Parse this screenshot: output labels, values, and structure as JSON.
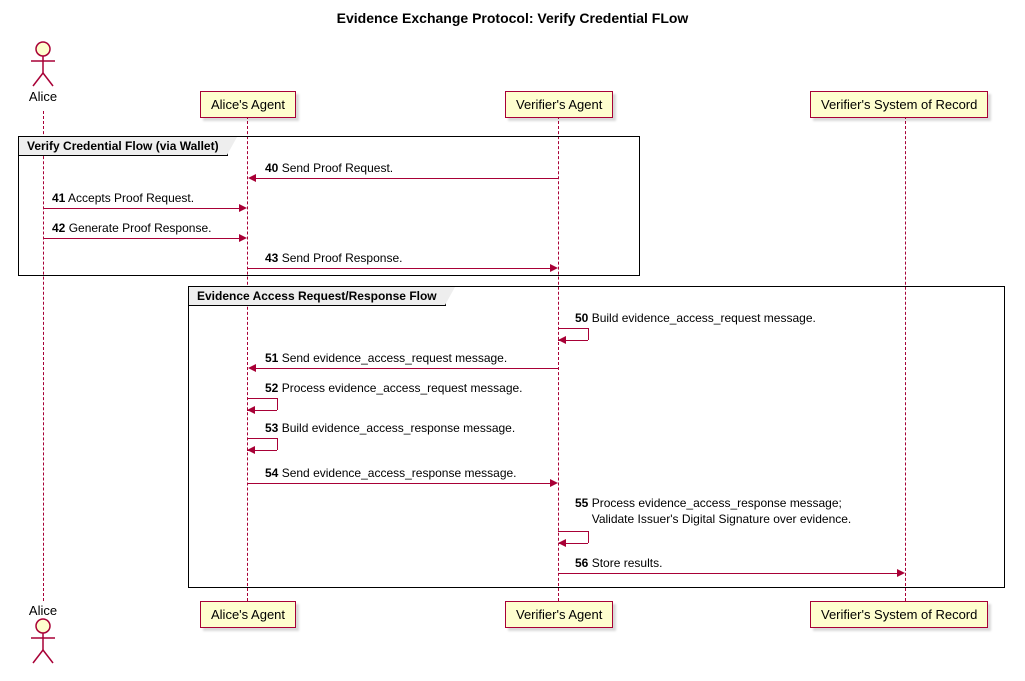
{
  "title": "Evidence Exchange Protocol: Verify Credential FLow",
  "participants": {
    "alice": "Alice",
    "alice_agent": "Alice's Agent",
    "verifier_agent": "Verifier's Agent",
    "verifier_sor": "Verifier's System of Record"
  },
  "groups": {
    "g1": "Verify Credential Flow (via Wallet)",
    "g2": "Evidence Access Request/Response Flow"
  },
  "messages": {
    "m40": {
      "num": "40",
      "text": "Send Proof Request."
    },
    "m41": {
      "num": "41",
      "text": "Accepts Proof Request."
    },
    "m42": {
      "num": "42",
      "text": "Generate Proof Response."
    },
    "m43": {
      "num": "43",
      "text": "Send Proof Response."
    },
    "m50": {
      "num": "50",
      "text": "Build evidence_access_request message."
    },
    "m51": {
      "num": "51",
      "text": "Send evidence_access_request message."
    },
    "m52": {
      "num": "52",
      "text": "Process evidence_access_request message."
    },
    "m53": {
      "num": "53",
      "text": "Build evidence_access_response message."
    },
    "m54": {
      "num": "54",
      "text": "Send evidence_access_response message."
    },
    "m55": {
      "num": "55",
      "text_line1": "Process evidence_access_response message;",
      "text_line2": "Validate Issuer's Digital Signature over evidence."
    },
    "m56": {
      "num": "56",
      "text": "Store results."
    }
  }
}
